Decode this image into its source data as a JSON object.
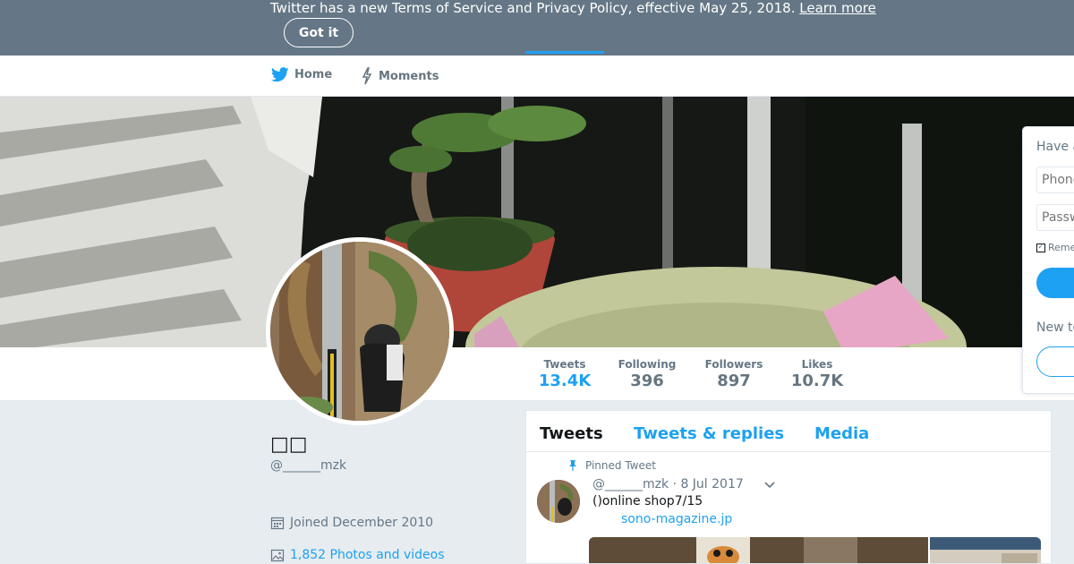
{
  "banner": {
    "text": "Twitter has a new Terms of Service and Privacy Policy, effective May 25, 2018.",
    "link_label": "Learn more",
    "button_label": "Got it"
  },
  "nav": {
    "home_label": "Home",
    "moments_label": "Moments"
  },
  "stats": [
    {
      "label": "Tweets",
      "value": "13.4K"
    },
    {
      "label": "Following",
      "value": "396"
    },
    {
      "label": "Followers",
      "value": "897"
    },
    {
      "label": "Likes",
      "value": "10.7K"
    }
  ],
  "profile": {
    "name": "□□",
    "handle": "@______mzk",
    "joined": "Joined December 2010",
    "photos": "1,852 Photos and videos"
  },
  "timeline": {
    "tabs": [
      "Tweets",
      "Tweets & replies",
      "Media"
    ],
    "pinned_label": "Pinned Tweet",
    "tweet": {
      "handle": "@______mzk",
      "date": "· 8 Jul 2017",
      "text": "()online shop7/15",
      "link": "sono-magazine.jp"
    }
  },
  "login": {
    "title": "Have a",
    "phone_placeholder": "Phone",
    "password_placeholder": "Passw",
    "remember_label": "Remer",
    "new_label": "New to"
  },
  "colors": {
    "accent": "#1da1f2",
    "banner_bg": "#657786",
    "page_bg": "#e6ecf0"
  }
}
